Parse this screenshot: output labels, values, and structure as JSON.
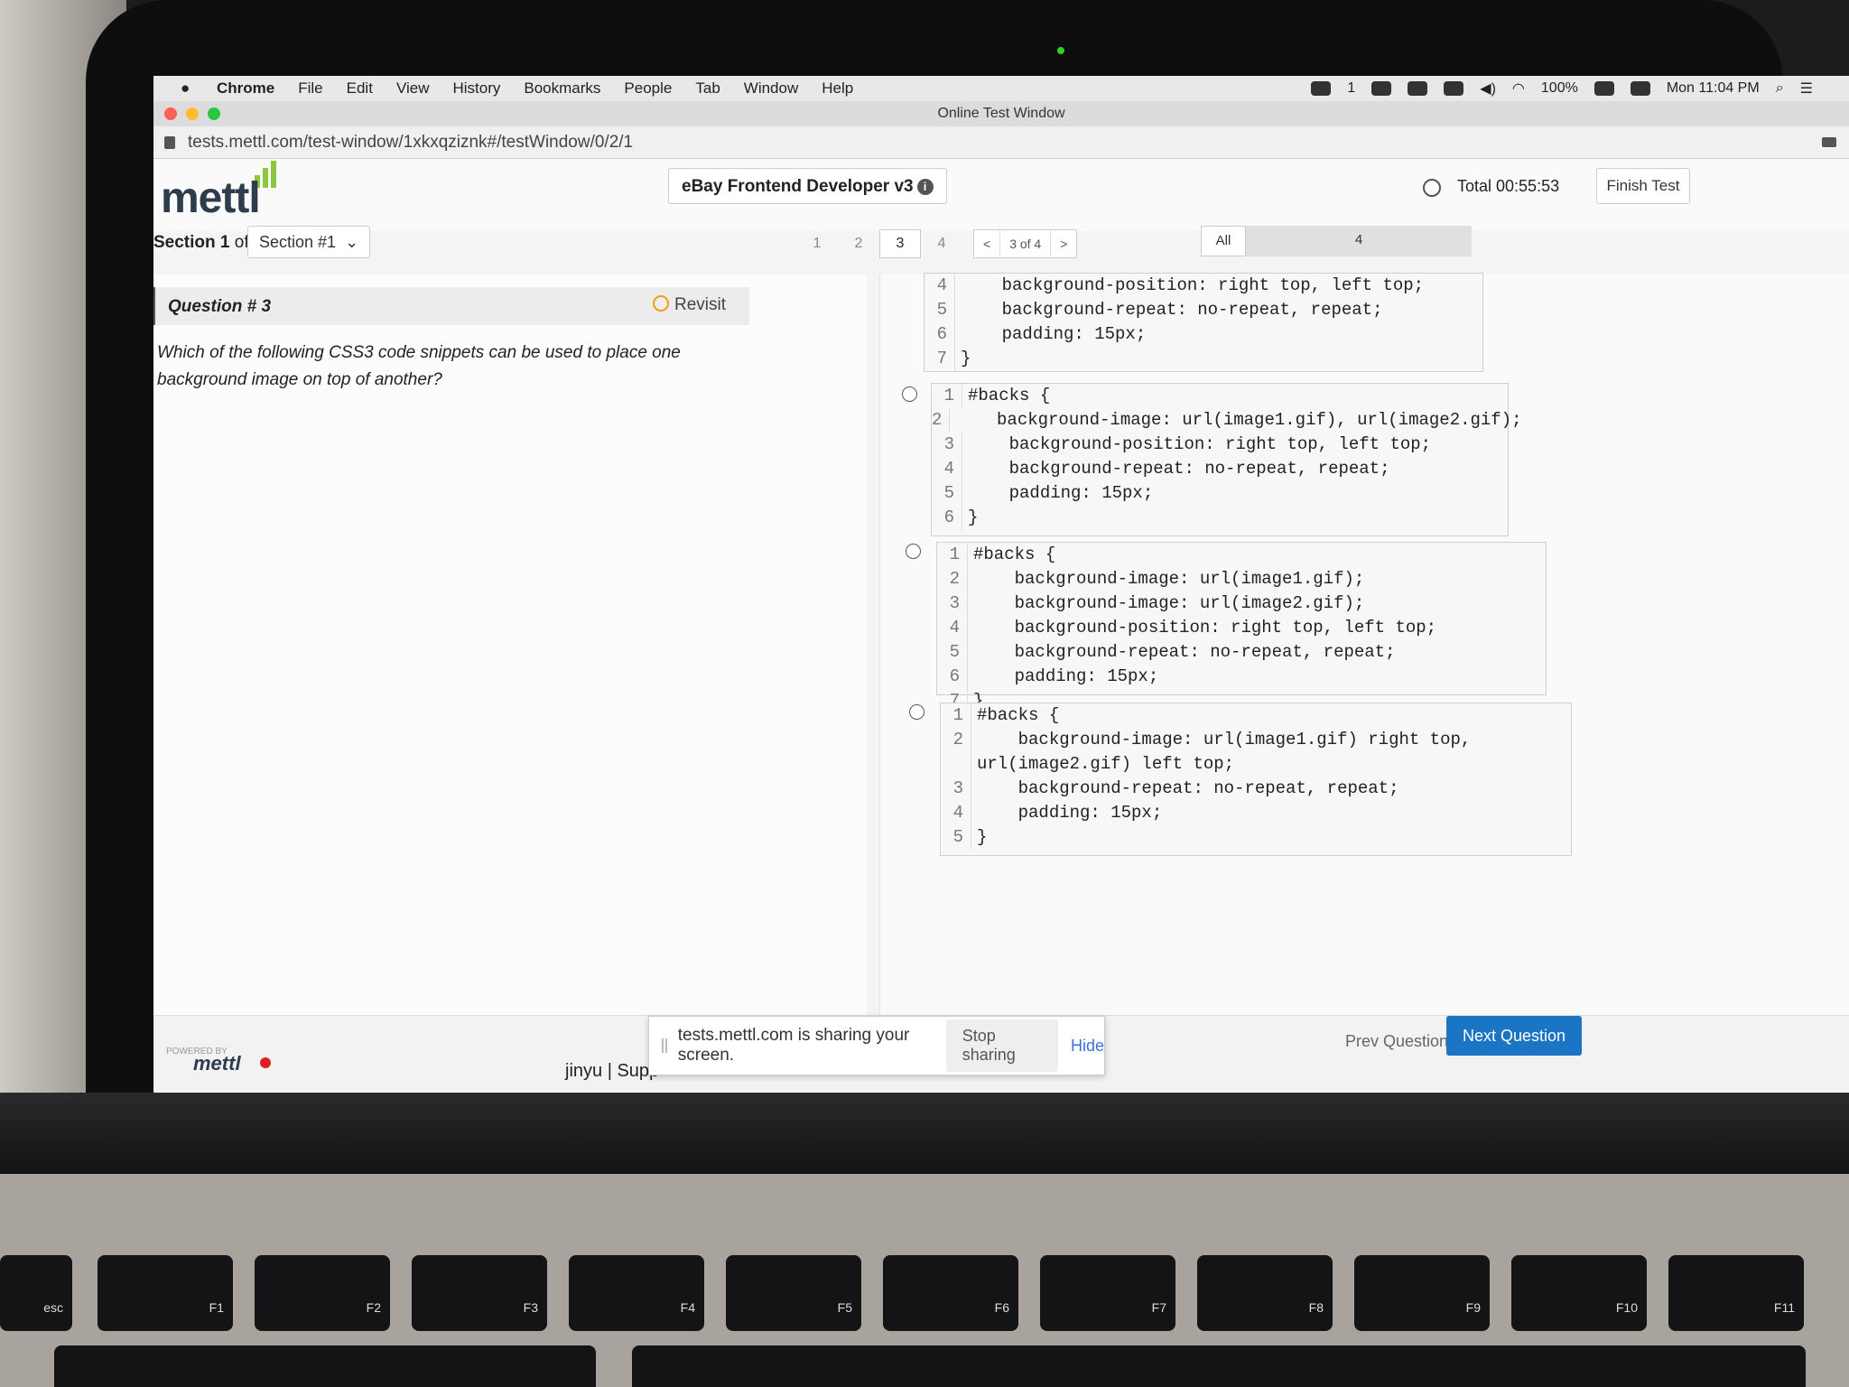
{
  "menubar": {
    "items": [
      "Chrome",
      "File",
      "Edit",
      "View",
      "History",
      "Bookmarks",
      "People",
      "Tab",
      "Window",
      "Help"
    ],
    "wechat_count": "1",
    "battery": "100%",
    "clock": "Mon 11:04 PM"
  },
  "window": {
    "title": "Online Test Window"
  },
  "address": {
    "url": "tests.mettl.com/test-window/1xkxqziznk#/testWindow/0/2/1"
  },
  "header": {
    "logo": "mettl",
    "test_name": "eBay Frontend Developer v3",
    "timer": "Total 00:55:53",
    "finish_label": "Finish Test"
  },
  "section": {
    "label_prefix": "Section",
    "number": "1",
    "of": "of 1",
    "selected": "Section #1",
    "questions": [
      "1",
      "2",
      "3",
      "4"
    ],
    "pager": {
      "prev": "<",
      "position": "3 of 4",
      "next": ">"
    },
    "filter_all": "All",
    "filter_count": "4"
  },
  "question": {
    "title": "Question # 3",
    "revisit": "Revisit",
    "text": "Which of the following CSS3 code snippets can be used to place one background image on top of another?"
  },
  "options": [
    {
      "lines": [
        {
          "n": "4",
          "t": "    background-position: right top, left top;"
        },
        {
          "n": "5",
          "t": "    background-repeat: no-repeat, repeat;"
        },
        {
          "n": "6",
          "t": "    padding: 15px;"
        },
        {
          "n": "7",
          "t": "}"
        }
      ]
    },
    {
      "lines": [
        {
          "n": "1",
          "t": "#backs {"
        },
        {
          "n": "2",
          "t": "    background-image: url(image1.gif), url(image2.gif);"
        },
        {
          "n": "3",
          "t": "    background-position: right top, left top;"
        },
        {
          "n": "4",
          "t": "    background-repeat: no-repeat, repeat;"
        },
        {
          "n": "5",
          "t": "    padding: 15px;"
        },
        {
          "n": "6",
          "t": "}"
        }
      ]
    },
    {
      "lines": [
        {
          "n": "1",
          "t": "#backs {"
        },
        {
          "n": "2",
          "t": "    background-image: url(image1.gif);"
        },
        {
          "n": "3",
          "t": "    background-image: url(image2.gif);"
        },
        {
          "n": "4",
          "t": "    background-position: right top, left top;"
        },
        {
          "n": "5",
          "t": "    background-repeat: no-repeat, repeat;"
        },
        {
          "n": "6",
          "t": "    padding: 15px;"
        },
        {
          "n": "7",
          "t": "}"
        }
      ]
    },
    {
      "lines": [
        {
          "n": "1",
          "t": "#backs {"
        },
        {
          "n": "2",
          "t": "    background-image: url(image1.gif) right top,"
        },
        {
          "n": "",
          "t": "url(image2.gif) left top;"
        },
        {
          "n": "3",
          "t": "    background-repeat: no-repeat, repeat;"
        },
        {
          "n": "4",
          "t": "    padding: 15px;"
        },
        {
          "n": "5",
          "t": "}"
        }
      ]
    }
  ],
  "footer": {
    "powered_by": "POWERED BY",
    "logo": "mettl",
    "user": "jinyu | Supp",
    "share_text": "tests.mettl.com is sharing your screen.",
    "stop_sharing": "Stop sharing",
    "hide": "Hide",
    "prev": "Prev Question",
    "next": "Next Question"
  },
  "keyboard": {
    "fkeys": [
      "F1",
      "F2",
      "F3",
      "F4",
      "F5",
      "F6",
      "F7",
      "F8",
      "F9",
      "F10",
      "F11"
    ],
    "esc": "esc"
  },
  "colors": {
    "accent": "#1b74c4",
    "logo_green": "#8dc63f",
    "logo_text": "#2d3d4e"
  }
}
